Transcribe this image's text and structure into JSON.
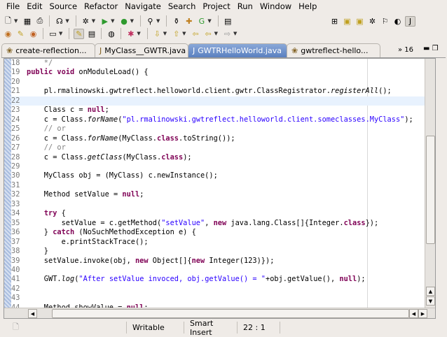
{
  "menu": [
    "File",
    "Edit",
    "Source",
    "Refactor",
    "Navigate",
    "Search",
    "Project",
    "Run",
    "Window",
    "Help"
  ],
  "menu_mnemonic": [
    0,
    0,
    0,
    5,
    0,
    null,
    0,
    0,
    0,
    0
  ],
  "toolbar1": [
    {
      "icon": "new-wizard-icon",
      "glyph": "🗋",
      "dd": true
    },
    {
      "icon": "save-icon",
      "glyph": "▦"
    },
    {
      "icon": "print-icon",
      "glyph": "⎙"
    },
    {
      "sep": true
    },
    {
      "icon": "gwt-compile-icon",
      "glyph": "☊",
      "dd": true
    },
    {
      "sep": true
    },
    {
      "icon": "debug-icon",
      "glyph": "✲",
      "dd": true
    },
    {
      "icon": "run-icon",
      "glyph": "▶",
      "dd": true,
      "color": "#2e9a2e"
    },
    {
      "icon": "run-external-tool-icon",
      "glyph": "●",
      "dd": true,
      "color": "#2e9a2e"
    },
    {
      "sep": true
    },
    {
      "icon": "search-icon",
      "glyph": "⚲",
      "dd": true
    },
    {
      "sep": true
    },
    {
      "icon": "new-java-project-icon",
      "glyph": "⚱"
    },
    {
      "icon": "new-package-icon",
      "glyph": "✚",
      "color": "#c08020"
    },
    {
      "icon": "new-class-icon",
      "glyph": "G",
      "dd": true,
      "color": "#2e9a2e"
    },
    {
      "sep": true
    },
    {
      "icon": "open-task-icon",
      "glyph": "▤"
    }
  ],
  "toolbar_right": [
    {
      "icon": "open-perspective-icon",
      "glyph": "⊞"
    },
    {
      "icon": "java-ee-perspective-icon",
      "glyph": "▣",
      "color": "#c0a020"
    },
    {
      "icon": "database-perspective-icon",
      "glyph": "▣",
      "color": "#c0a020"
    },
    {
      "icon": "debug-perspective-icon",
      "glyph": "✲"
    },
    {
      "icon": "team-perspective-icon",
      "glyph": "⚐"
    },
    {
      "icon": "plugin-perspective-icon",
      "glyph": "◐"
    },
    {
      "icon": "java-perspective-icon",
      "glyph": "J",
      "active": true
    }
  ],
  "toolbar2": [
    {
      "icon": "open-type-icon",
      "glyph": "◉",
      "color": "#c07020"
    },
    {
      "icon": "open-resource-icon",
      "glyph": "✎",
      "color": "#c0a020"
    },
    {
      "icon": "open-task-list-icon",
      "glyph": "◉",
      "color": "#c06020"
    },
    {
      "sep": true
    },
    {
      "icon": "open-folder-icon",
      "glyph": "▭",
      "dd": true
    },
    {
      "sep": true
    },
    {
      "icon": "toggle-mark-occurrences-icon",
      "glyph": "✎",
      "active": true,
      "color": "#c0a020"
    },
    {
      "icon": "show-whitespace-icon",
      "glyph": "▤"
    },
    {
      "sep": true
    },
    {
      "icon": "web-browser-icon",
      "glyph": "◍"
    },
    {
      "sep": true
    },
    {
      "icon": "breakpoint-icon",
      "glyph": "✱",
      "dd": true,
      "color": "#c03060"
    },
    {
      "sep": true
    },
    {
      "icon": "next-annotation-icon",
      "glyph": "⇩",
      "dd": true,
      "color": "#c0a020"
    },
    {
      "icon": "previous-annotation-icon",
      "glyph": "⇧",
      "dd": true,
      "color": "#c0a020"
    },
    {
      "icon": "last-edit-location-icon",
      "glyph": "⇦",
      "color": "#c0a020"
    },
    {
      "icon": "back-icon",
      "glyph": "⇦",
      "dd": true,
      "color": "#c0a020"
    },
    {
      "icon": "forward-icon",
      "glyph": "⇨",
      "dd": true,
      "color": "#999"
    }
  ],
  "tabs": [
    {
      "label": "create-reflection...",
      "icon": "ant-icon",
      "glyph": "❀"
    },
    {
      "label": "MyClass__GWTR.java",
      "icon": "java-file-icon",
      "glyph": "J"
    },
    {
      "label": "GWTRHelloWorld.java",
      "icon": "java-file-icon",
      "glyph": "J",
      "active": true
    },
    {
      "label": "gwtreflect-hello...",
      "icon": "ant-icon",
      "glyph": "❀"
    }
  ],
  "tabs_overflow": "16",
  "editor": {
    "current_line": 22,
    "lines": [
      {
        "n": "18",
        "seg": [
          [
            "    */",
            "c"
          ]
        ]
      },
      {
        "n": "19",
        "seg": [
          [
            "public",
            "k"
          ],
          [
            " ",
            ""
          ],
          [
            "void",
            "k"
          ],
          [
            " onModuleLoad() {",
            ""
          ]
        ]
      },
      {
        "n": "20",
        "seg": []
      },
      {
        "n": "21",
        "seg": [
          [
            "    pl.rmalinowski.gwtreflect.helloworld.client.gwtr.ClassRegistrator.",
            ""
          ],
          [
            "registerAll",
            "i"
          ],
          [
            "();",
            ""
          ]
        ]
      },
      {
        "n": "22",
        "seg": []
      },
      {
        "n": "23",
        "seg": [
          [
            "    Class c = ",
            ""
          ],
          [
            "null",
            "k"
          ],
          [
            ";",
            ""
          ]
        ]
      },
      {
        "n": "24",
        "seg": [
          [
            "    c = Class.",
            ""
          ],
          [
            "forName",
            "i"
          ],
          [
            "(",
            ""
          ],
          [
            "\"pl.rmalinowski.gwtreflect.helloworld.client.someclasses.MyClass\"",
            "s"
          ],
          [
            ");",
            ""
          ]
        ]
      },
      {
        "n": "25",
        "seg": [
          [
            "    // or",
            "c"
          ]
        ]
      },
      {
        "n": "26",
        "seg": [
          [
            "    c = Class.",
            ""
          ],
          [
            "forName",
            "i"
          ],
          [
            "(MyClass.",
            ""
          ],
          [
            "class",
            "k"
          ],
          [
            ".toString());",
            ""
          ]
        ]
      },
      {
        "n": "27",
        "seg": [
          [
            "    // or",
            "c"
          ]
        ]
      },
      {
        "n": "28",
        "seg": [
          [
            "    c = Class.",
            ""
          ],
          [
            "getClass",
            "i"
          ],
          [
            "(MyClass.",
            ""
          ],
          [
            "class",
            "k"
          ],
          [
            ");",
            ""
          ]
        ]
      },
      {
        "n": "29",
        "seg": []
      },
      {
        "n": "30",
        "seg": [
          [
            "    MyClass obj = (MyClass) c.newInstance();",
            ""
          ]
        ]
      },
      {
        "n": "31",
        "seg": []
      },
      {
        "n": "32",
        "seg": [
          [
            "    Method setValue = ",
            ""
          ],
          [
            "null",
            "k"
          ],
          [
            ";",
            ""
          ]
        ]
      },
      {
        "n": "33",
        "seg": []
      },
      {
        "n": "34",
        "seg": [
          [
            "    ",
            ""
          ],
          [
            "try",
            "k"
          ],
          [
            " {",
            ""
          ]
        ]
      },
      {
        "n": "35",
        "seg": [
          [
            "        setValue = c.getMethod(",
            ""
          ],
          [
            "\"setValue\"",
            "s"
          ],
          [
            ", ",
            ""
          ],
          [
            "new",
            "k"
          ],
          [
            " java.lang.Class[]{Integer.",
            ""
          ],
          [
            "class",
            "k"
          ],
          [
            "});",
            ""
          ]
        ]
      },
      {
        "n": "36",
        "seg": [
          [
            "    } ",
            ""
          ],
          [
            "catch",
            "k"
          ],
          [
            " (NoSuchMethodException e) {",
            ""
          ]
        ]
      },
      {
        "n": "37",
        "seg": [
          [
            "        e.printStackTrace();",
            ""
          ]
        ]
      },
      {
        "n": "38",
        "seg": [
          [
            "    }",
            ""
          ]
        ]
      },
      {
        "n": "39",
        "seg": [
          [
            "    setValue.invoke(obj, ",
            ""
          ],
          [
            "new",
            "k"
          ],
          [
            " Object[]{",
            ""
          ],
          [
            "new",
            "k"
          ],
          [
            " Integer(123)});",
            ""
          ]
        ]
      },
      {
        "n": "40",
        "seg": []
      },
      {
        "n": "41",
        "seg": [
          [
            "    GWT.",
            ""
          ],
          [
            "log",
            "i"
          ],
          [
            "(",
            ""
          ],
          [
            "\"After setValue invoced, obj.getValue() = \"",
            "s"
          ],
          [
            "+obj.getValue(), ",
            ""
          ],
          [
            "null",
            "k"
          ],
          [
            ");",
            ""
          ]
        ]
      },
      {
        "n": "42",
        "seg": []
      },
      {
        "n": "43",
        "seg": []
      },
      {
        "n": "44",
        "seg": [
          [
            "    Method showValue = ",
            ""
          ],
          [
            "null",
            "k"
          ],
          [
            ";",
            ""
          ]
        ]
      }
    ]
  },
  "status": {
    "mode": "Writable",
    "insert": "Smart Insert",
    "position": "22 : 1"
  },
  "colors": {
    "keyword": "#7f0055",
    "string": "#2a00ff",
    "comment": "#808080",
    "active_tab": "#5a80c0",
    "current_line": "#e8f2fe"
  }
}
